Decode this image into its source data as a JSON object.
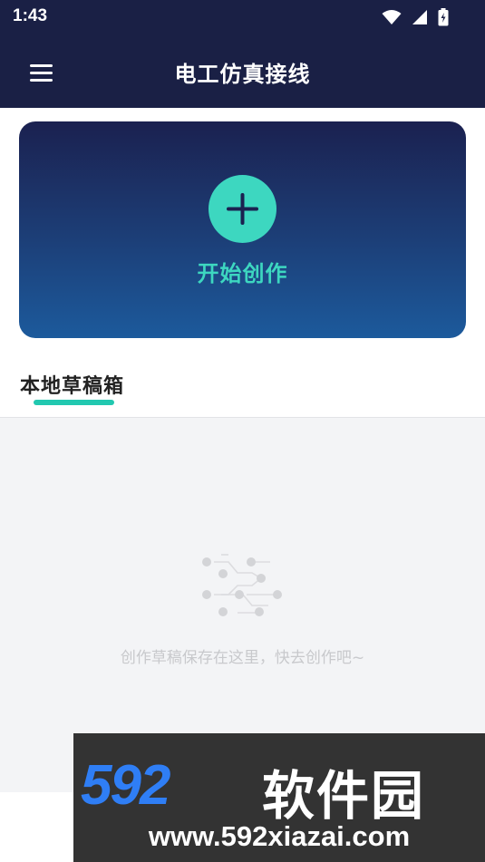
{
  "status_bar": {
    "time": "1:43"
  },
  "app_bar": {
    "title": "电工仿真接线"
  },
  "create_card": {
    "label": "开始创作"
  },
  "tabs": [
    {
      "label": "本地草稿箱",
      "selected": true
    }
  ],
  "empty_state": {
    "message": "创作草稿保存在这里，快去创作吧~"
  },
  "watermark": {
    "brand_number": "592",
    "brand_text": "软件园",
    "url": "www.592xiazai.com"
  },
  "colors": {
    "header_bg": "#1a2045",
    "accent": "#3dd7c0",
    "tab_indicator": "#22c8b0",
    "watermark_blue": "#2f7ef5"
  }
}
